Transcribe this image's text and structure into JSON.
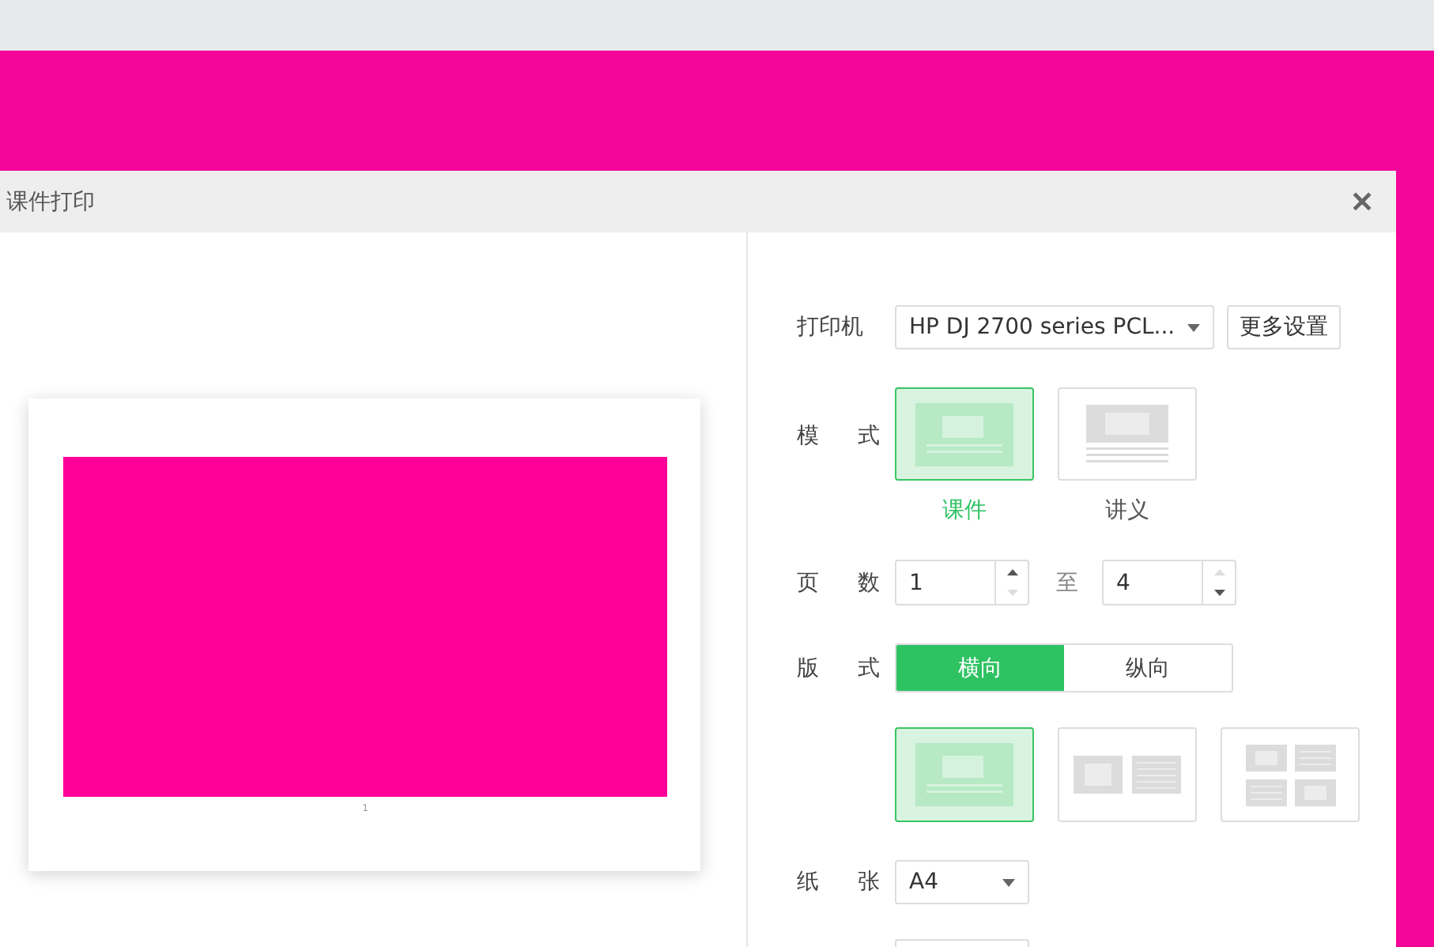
{
  "dialog": {
    "title": "课件打印",
    "close": "✕"
  },
  "preview": {
    "pages": [
      {
        "number": "1"
      }
    ]
  },
  "settings": {
    "printer": {
      "label": "打印机",
      "value": "HP DJ 2700 series PCL...",
      "more_button": "更多设置"
    },
    "mode": {
      "label": "模 式",
      "options": [
        {
          "label": "课件",
          "kind": "slide",
          "selected": true
        },
        {
          "label": "讲义",
          "kind": "handout",
          "selected": false
        }
      ]
    },
    "pages": {
      "label": "页 数",
      "from": {
        "value": "1",
        "up_disabled": false,
        "down_disabled": true
      },
      "separator": "至",
      "to": {
        "value": "4",
        "up_disabled": true,
        "down_disabled": false
      }
    },
    "layout": {
      "label": "版 式",
      "orientations": [
        {
          "label": "横向",
          "selected": true
        },
        {
          "label": "纵向",
          "selected": false
        }
      ],
      "arrangements": [
        {
          "kind": "one",
          "selected": true
        },
        {
          "kind": "two",
          "selected": false
        },
        {
          "kind": "four",
          "selected": false
        }
      ]
    },
    "paper": {
      "label": "纸 张",
      "value": "A4"
    }
  }
}
